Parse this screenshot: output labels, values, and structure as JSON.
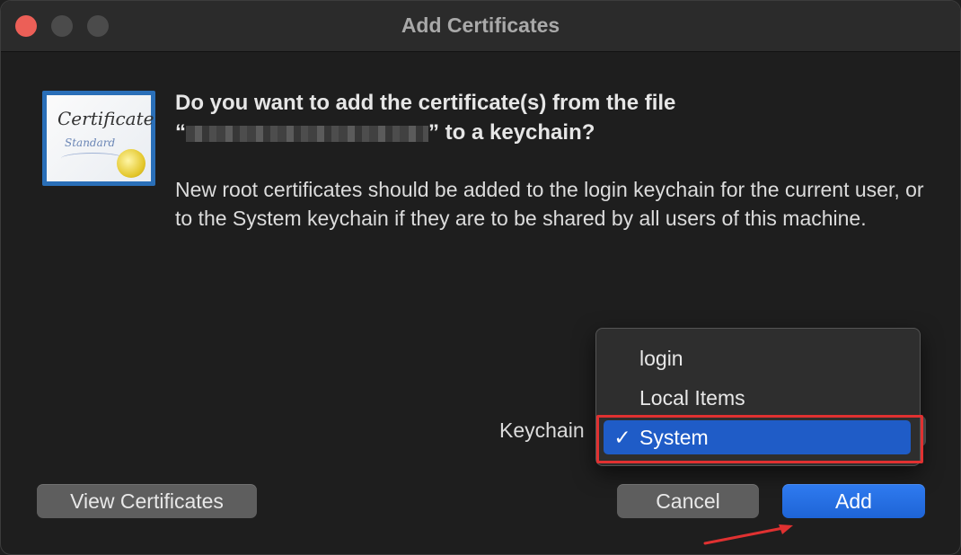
{
  "window": {
    "title": "Add Certificates"
  },
  "certificate_icon": {
    "word": "Certificate",
    "subword": "Standard"
  },
  "dialog": {
    "heading_line1": "Do you want to add the certificate(s) from the file",
    "heading_line2_prefix": "“",
    "heading_line2_suffix": "” to a keychain?",
    "body": "New root certificates should be added to the login keychain for the current user, or to the System keychain if they are to be shared by all users of this machine."
  },
  "keychain": {
    "label": "Keychain",
    "options": [
      "login",
      "Local Items",
      "System"
    ],
    "selected": "System",
    "check_mark": "✓"
  },
  "buttons": {
    "view_certificates": "View Certificates",
    "cancel": "Cancel",
    "add": "Add"
  },
  "colors": {
    "accent": "#1f5cc7",
    "annotation_red": "#e03131"
  }
}
